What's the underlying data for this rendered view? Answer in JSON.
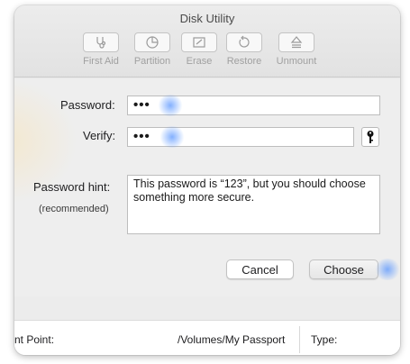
{
  "window": {
    "title": "Disk Utility"
  },
  "toolbar": {
    "items": [
      {
        "label": "First Aid",
        "icon": "stethoscope-icon"
      },
      {
        "label": "Partition",
        "icon": "pie-chart-icon"
      },
      {
        "label": "Erase",
        "icon": "erase-icon"
      },
      {
        "label": "Restore",
        "icon": "restore-icon"
      },
      {
        "label": "Unmount",
        "icon": "eject-icon"
      }
    ]
  },
  "dialog": {
    "password_label": "Password:",
    "password_value": "•••",
    "verify_label": "Verify:",
    "verify_value": "•••",
    "hint_label": "Password hint:",
    "hint_sublabel": "(recommended)",
    "hint_value": "This password is “123”, but you should choose something more secure.",
    "cancel_label": "Cancel",
    "choose_label": "Choose",
    "key_icon": "key-icon"
  },
  "info": {
    "mount_point_label": "nt Point:",
    "mount_point_value": "/Volumes/My Passport",
    "type_label": "Type:"
  },
  "colors": {
    "touch_highlight": "#5a96ff",
    "window_bg": "#ececec"
  }
}
